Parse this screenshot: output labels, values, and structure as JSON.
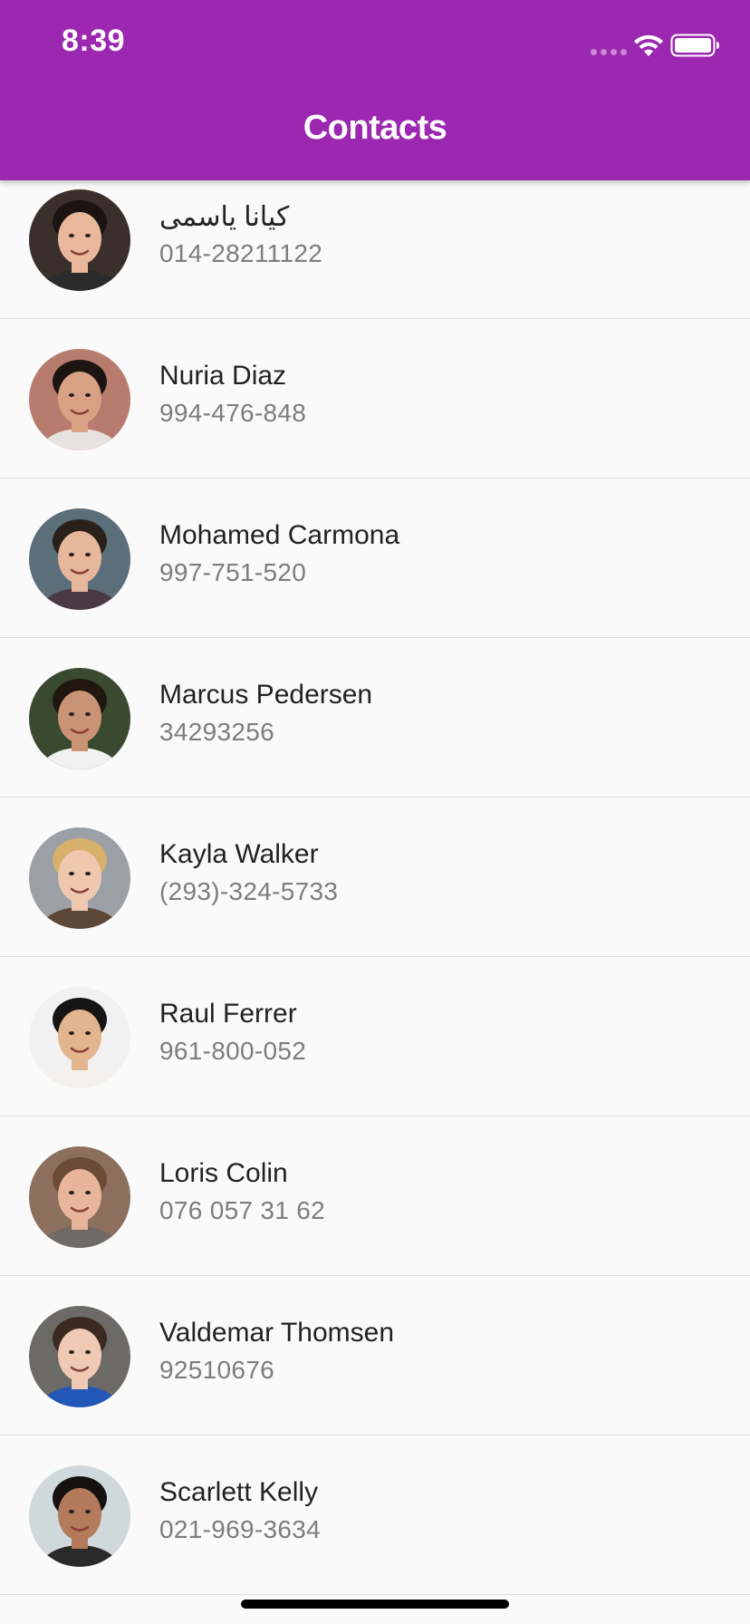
{
  "status_bar": {
    "time": "8:39"
  },
  "header": {
    "title": "Contacts",
    "background_color": "#9c27b0"
  },
  "contacts": [
    {
      "name": "كيانا ياسمی",
      "phone": "014-28211122",
      "avatar_icon": "person-avatar-icon"
    },
    {
      "name": "Nuria Diaz",
      "phone": "994-476-848",
      "avatar_icon": "person-avatar-icon"
    },
    {
      "name": "Mohamed Carmona",
      "phone": "997-751-520",
      "avatar_icon": "person-avatar-icon"
    },
    {
      "name": "Marcus Pedersen",
      "phone": "34293256",
      "avatar_icon": "person-avatar-icon"
    },
    {
      "name": "Kayla Walker",
      "phone": "(293)-324-5733",
      "avatar_icon": "person-avatar-icon"
    },
    {
      "name": "Raul Ferrer",
      "phone": "961-800-052",
      "avatar_icon": "person-avatar-icon"
    },
    {
      "name": "Loris Colin",
      "phone": "076 057 31 62",
      "avatar_icon": "person-avatar-icon"
    },
    {
      "name": "Valdemar Thomsen",
      "phone": "92510676",
      "avatar_icon": "person-avatar-icon"
    },
    {
      "name": "Scarlett Kelly",
      "phone": "021-969-3634",
      "avatar_icon": "person-avatar-icon"
    }
  ]
}
